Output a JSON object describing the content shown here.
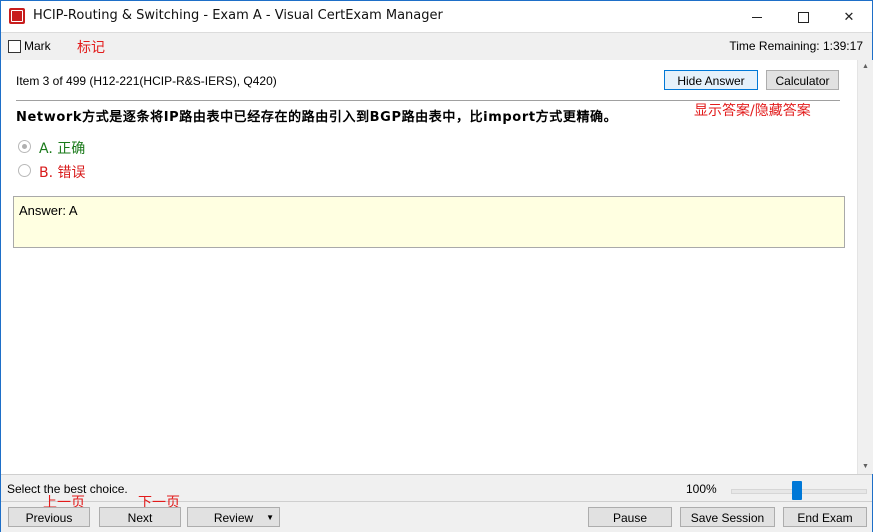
{
  "window": {
    "title": "HCIP-Routing & Switching - Exam A - Visual CertExam Manager",
    "minimize_glyph": "",
    "maximize_glyph": "",
    "close_glyph": "✕"
  },
  "toolbar": {
    "mark_label": "Mark",
    "mark_checked": false,
    "mark_annotation": "标记",
    "time_remaining_label": "Time Remaining:",
    "time_remaining_value": "1:39:17"
  },
  "question": {
    "item_info": "Item 3 of 499  (H12-221(HCIP-R&S-IERS), Q420)",
    "hide_answer_label": "Hide Answer",
    "calculator_label": "Calculator",
    "show_hide_annotation": "显示答案/隐藏答案",
    "text": "Network方式是逐条将IP路由表中已经存在的路由引入到BGP路由表中，比import方式更精确。",
    "options": [
      {
        "letter": "A.",
        "text": "正确",
        "selected": true
      },
      {
        "letter": "B.",
        "text": "错误",
        "selected": false
      }
    ],
    "answer_text": "Answer: A"
  },
  "status": {
    "instruction": "Select the best choice.",
    "zoom_label": "100%",
    "zoom_value": 100
  },
  "navigation": {
    "previous_label": "Previous",
    "previous_annotation": "上一页",
    "next_label": "Next",
    "next_annotation": "下一页",
    "review_label": "Review",
    "pause_label": "Pause",
    "save_session_label": "Save Session",
    "end_exam_label": "End Exam"
  },
  "colors": {
    "annotation": "#e21b1b",
    "correct_option": "#1a7a1a",
    "wrong_option": "#d81b1b",
    "answer_background": "#ffffe1",
    "slider_accent": "#0078d7"
  },
  "icons": {
    "app": "app-logo-icon",
    "scroll_up": "scroll-up-arrow-icon",
    "scroll_down": "scroll-down-arrow-icon",
    "review_dropdown": "dropdown-caret-icon"
  }
}
